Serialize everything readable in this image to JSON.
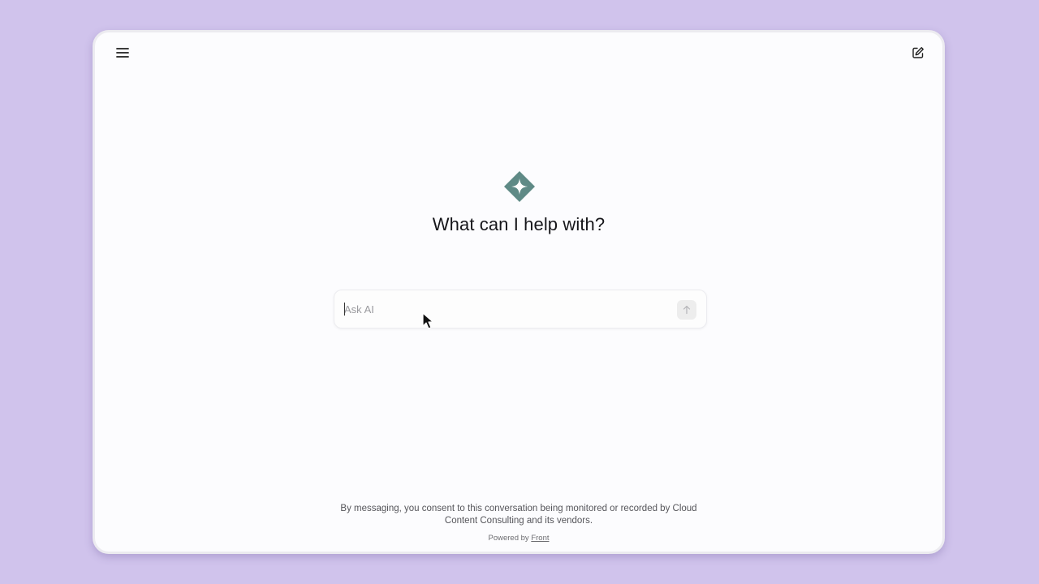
{
  "header": {
    "menu_icon": "hamburger-menu-icon",
    "compose_icon": "edit-compose-icon"
  },
  "hero": {
    "logo_icon": "sparkle-diamond-icon",
    "logo_color": "#5f8a86",
    "title": "What can I help with?"
  },
  "composer": {
    "placeholder": "Ask AI",
    "value": "",
    "send_icon": "arrow-up-icon"
  },
  "footer": {
    "consent_text": "By messaging, you consent to this conversation being monitored or recorded by Cloud Content Consulting and its vendors.",
    "powered_prefix": "Powered by",
    "powered_link": "Front"
  },
  "colors": {
    "background": "#d0c3ec",
    "window": "#fcfcfe",
    "accent": "#5f8a86"
  }
}
